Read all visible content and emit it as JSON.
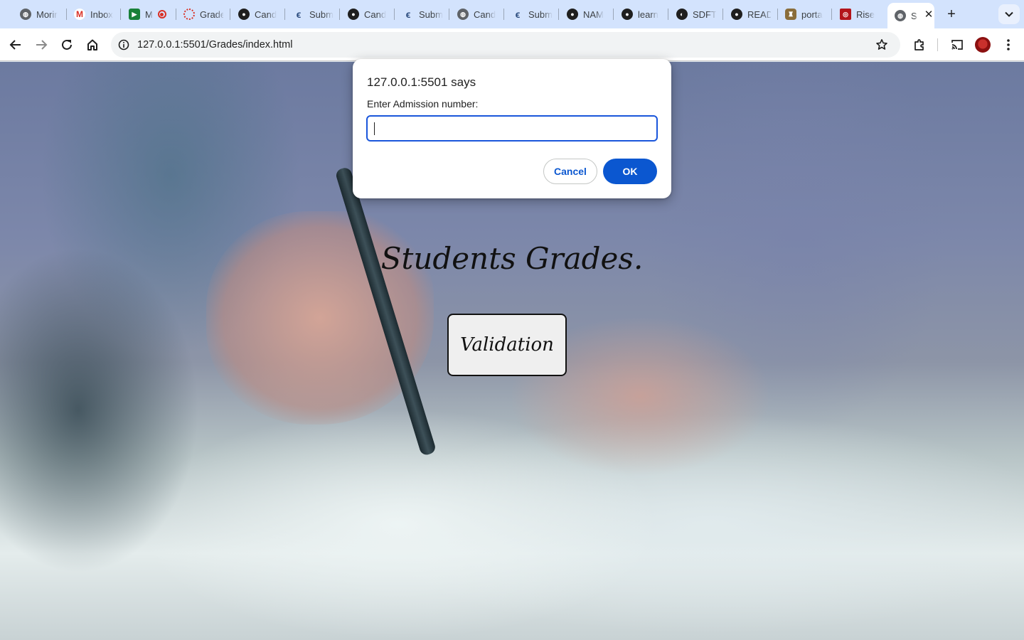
{
  "browser": {
    "tabs": [
      {
        "label": "Morir",
        "icon": "globe-icon",
        "color": "#5f6368"
      },
      {
        "label": "Inbox",
        "icon": "gmail-icon",
        "color": "#d93025"
      },
      {
        "label": "M",
        "icon": "meet-icon",
        "color": "#188038"
      },
      {
        "label": "Grade",
        "icon": "ring-icon",
        "color": "#d93025"
      },
      {
        "label": "Cand",
        "icon": "github-icon",
        "color": "#1f1f1f"
      },
      {
        "label": "Subm",
        "icon": "moringa-icon",
        "color": "#2b4c7e"
      },
      {
        "label": "Cand",
        "icon": "github-icon",
        "color": "#1f1f1f"
      },
      {
        "label": "Subm",
        "icon": "moringa-icon",
        "color": "#2b4c7e"
      },
      {
        "label": "Cand",
        "icon": "globe-icon",
        "color": "#5f6368"
      },
      {
        "label": "Subm",
        "icon": "moringa-icon",
        "color": "#2b4c7e"
      },
      {
        "label": "NAM",
        "icon": "github-icon",
        "color": "#1f1f1f"
      },
      {
        "label": "learn",
        "icon": "github-icon",
        "color": "#1f1f1f"
      },
      {
        "label": "SDFT",
        "icon": "sdft-icon",
        "color": "#1f1f1f"
      },
      {
        "label": "READ",
        "icon": "github-icon",
        "color": "#1f1f1f"
      },
      {
        "label": "porta",
        "icon": "crest-icon",
        "color": "#8a6d3b"
      },
      {
        "label": "Rise",
        "icon": "rise-icon",
        "color": "#b3141b"
      }
    ],
    "active_tab": {
      "label": "S",
      "icon": "globe-icon"
    },
    "address": "127.0.0.1:5501/Grades/index.html"
  },
  "page": {
    "heading": "Students Grades.",
    "button_label": "Validation"
  },
  "dialog": {
    "title": "127.0.0.1:5501 says",
    "message": "Enter Admission number:",
    "input_value": "",
    "cancel_label": "Cancel",
    "ok_label": "OK"
  },
  "colors": {
    "accent": "#0b57d0",
    "tabstrip": "#d3e3fd"
  }
}
